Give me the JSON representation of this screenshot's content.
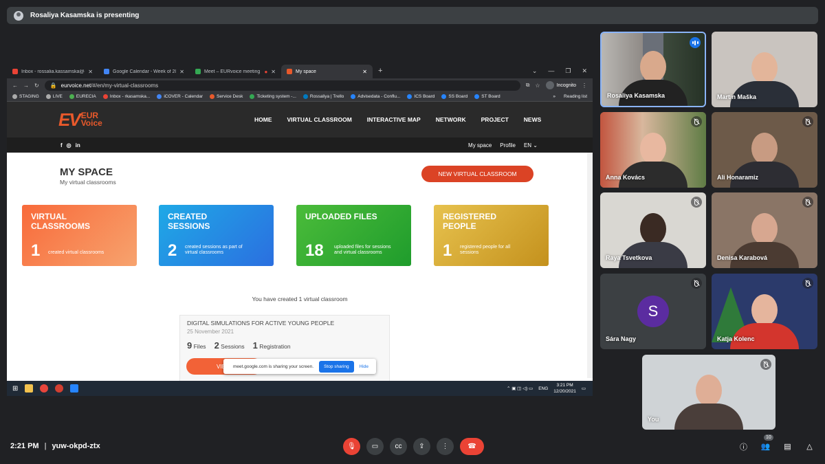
{
  "presenter_banner": "Rosaliya Kasamska is presenting",
  "browser": {
    "tabs": [
      {
        "title": "Inbox - rossalia.kassamska@gma",
        "color": "#ea4335"
      },
      {
        "title": "Google Calendar - Week of 20 De",
        "color": "#4285f4"
      },
      {
        "title": "Meet – EURvoice meeting",
        "color": "#34a853"
      },
      {
        "title": "My space",
        "color": "#e8592b"
      }
    ],
    "url_host": "eurvoice.net",
    "url_path": "/#/en/my-virtual-classrooms",
    "incognito": "Incognito",
    "bookmarks": [
      "STAGING",
      "LIVE",
      "EURECIA",
      "Inbox - rkasamska...",
      "iCOVER - Calendar",
      "Service Desk",
      "Ticketing system -...",
      "Rossaliya | Trello",
      "Advisedata - Conflu...",
      "ICS Board",
      "SS Board",
      "ST Board"
    ],
    "reading_list": "Reading list"
  },
  "site": {
    "logo_ev": "EV",
    "logo_line1": "EUR",
    "logo_line2": "Voice",
    "nav": [
      "HOME",
      "VIRTUAL CLASSROOM",
      "INTERACTIVE MAP",
      "NETWORK",
      "PROJECT",
      "NEWS"
    ],
    "social": [
      "f",
      "◎",
      "in"
    ],
    "sub_nav": [
      "My space",
      "Profile",
      "EN ⌄"
    ],
    "page_title": "MY SPACE",
    "page_subtitle": "My virtual classrooms",
    "new_button": "NEW VIRTUAL CLASSROOM",
    "cards": [
      {
        "title": "VIRTUAL CLASSROOMS",
        "num": "1",
        "desc": "created virtual classrooms"
      },
      {
        "title": "CREATED SESSIONS",
        "num": "2",
        "desc": "created sessions as part of virtual classrooms"
      },
      {
        "title": "UPLOADED FILES",
        "num": "18",
        "desc": "uploaded files for sessions and virtual classrooms"
      },
      {
        "title": "REGISTERED PEOPLE",
        "num": "1",
        "desc": "registered people for all sessions"
      }
    ],
    "created_message": "You have created 1 virtual classroom",
    "classroom": {
      "title": "DIGITAL SIMULATIONS FOR ACTIVE YOUNG PEOPLE",
      "date": "25 November 2021",
      "files_num": "9",
      "files_label": "Files",
      "sessions_num": "2",
      "sessions_label": "Sessions",
      "reg_num": "1",
      "reg_label": "Registration",
      "view_label": "VIE"
    },
    "share_notice": "meet.google.com is sharing your screen.",
    "stop_sharing": "Stop sharing",
    "hide": "Hide"
  },
  "taskbar": {
    "lang": "ENG",
    "time": "3:21 PM",
    "date": "12/20/2021"
  },
  "participants": [
    {
      "name": "Rosaliya Kasamska",
      "speaking": true
    },
    {
      "name": "Martin Maška"
    },
    {
      "name": "Anna Kovács"
    },
    {
      "name": "Ali Honaramiz"
    },
    {
      "name": "Raya Tsvetkova"
    },
    {
      "name": "Denisa Karabová"
    },
    {
      "name": "Sára Nagy",
      "avatar": "S"
    },
    {
      "name": "Katja Kolenc"
    },
    {
      "name": "You"
    }
  ],
  "meeting": {
    "time": "2:21 PM",
    "code": "yuw-okpd-ztx",
    "people_count": "10"
  }
}
